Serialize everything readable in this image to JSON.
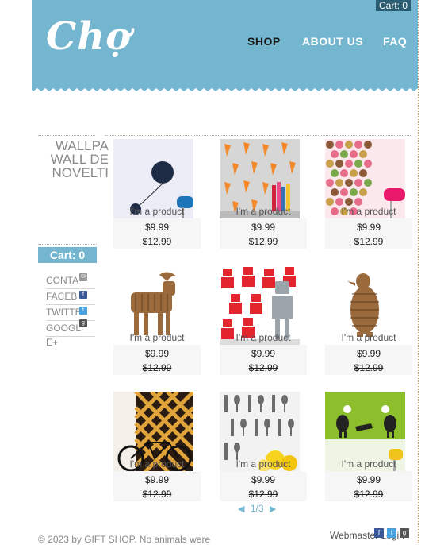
{
  "brand": {
    "logo_text": "Chợ"
  },
  "nav": {
    "shop": "SHOP",
    "about": "ABOUT US",
    "faq": "FAQ"
  },
  "cart_top": "Cart: 0",
  "sidebar": {
    "title_lines": [
      "WALLPA",
      "WALL DE",
      "NOVELTI"
    ],
    "cart_label": "Cart: 0",
    "links": [
      {
        "label": "CONTA",
        "icon": "mail-icon"
      },
      {
        "label": "FACEB",
        "icon": "facebook-icon"
      },
      {
        "label": "TWITTE",
        "icon": "twitter-icon"
      },
      {
        "label": "GOOGL",
        "icon": "google-plus-icon"
      }
    ],
    "extra": "E+"
  },
  "products": [
    {
      "name": "I'm a product",
      "price": "$9.99",
      "old_price": "$12.99"
    },
    {
      "name": "I'm a product",
      "price": "$9.99",
      "old_price": "$12.99"
    },
    {
      "name": "I'm a product",
      "price": "$9.99",
      "old_price": "$12.99"
    },
    {
      "name": "I'm a product",
      "price": "$9.99",
      "old_price": "$12.99"
    },
    {
      "name": "I'm a product",
      "price": "$9.99",
      "old_price": "$12.99"
    },
    {
      "name": "I'm a product",
      "price": "$9.99",
      "old_price": "$12.99"
    },
    {
      "name": "I'm a product",
      "price": "$9.99",
      "old_price": "$12.99"
    },
    {
      "name": "I'm a product",
      "price": "$9.99",
      "old_price": "$12.99"
    },
    {
      "name": "I'm a product",
      "price": "$9.99",
      "old_price": "$12.99"
    }
  ],
  "pager": {
    "prev": "◀",
    "label": "1/3",
    "next": "▶"
  },
  "footer": {
    "copyright": "© 2023 by GIFT SHOP. No animals were",
    "webmaster": "Webmaster Login"
  },
  "colors": {
    "header": "#74b6cf",
    "cart_dark": "#2b5d73",
    "text_gray": "#8a8a8a"
  }
}
